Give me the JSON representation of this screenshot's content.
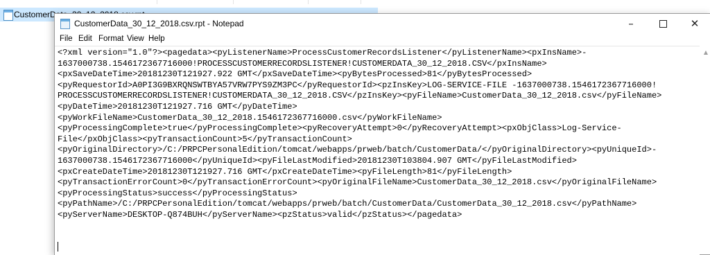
{
  "explorer": {
    "file_name": "CustomerData_30_12_2018.csv.rpt"
  },
  "window": {
    "title": "CustomerData_30_12_2018.csv.rpt - Notepad",
    "controls": {
      "minimize": "–",
      "close": "✕"
    }
  },
  "menu": [
    "File",
    "Edit",
    "Format",
    "View",
    "Help"
  ],
  "content_lines": [
    "<?xml version=\"1.0\"?><pagedata><pyListenerName>ProcessCustomerRecordsListener</pyListenerName><pxInsName>-",
    "1637000738.1546172367716000!PROCESSCUSTOMERRECORDSLISTENER!CUSTOMERDATA_30_12_2018.CSV</pxInsName>",
    "<pxSaveDateTime>20181230T121927.922 GMT</pxSaveDateTime><pyBytesProcessed>81</pyBytesProcessed>",
    "<pyRequestorId>A0PI3G9BXRQNSWTBYA57VRW7PYS9ZM3PC</pyRequestorId><pzInsKey>LOG-SERVICE-FILE -1637000738.1546172367716000!",
    "PROCESSCUSTOMERRECORDSLISTENER!CUSTOMERDATA_30_12_2018.CSV</pzInsKey><pyFileName>CustomerData_30_12_2018.csv</pyFileName>",
    "<pyDateTime>20181230T121927.716 GMT</pyDateTime>",
    "<pyWorkFileName>CustomerData_30_12_2018.1546172367716000.csv</pyWorkFileName>",
    "<pyProcessingComplete>true</pyProcessingComplete><pyRecoveryAttempt>0</pyRecoveryAttempt><pxObjClass>Log-Service-",
    "File</pxObjClass><pyTransactionCount>5</pyTransactionCount>",
    "<pyOriginalDirectory>/C:/PRPCPersonalEdition/tomcat/webapps/prweb/batch/CustomerData/</pyOriginalDirectory><pyUniqueId>-",
    "1637000738.1546172367716000</pyUniqueId><pyFileLastModified>20181230T103804.907 GMT</pyFileLastModified>",
    "<pxCreateDateTime>20181230T121927.716 GMT</pxCreateDateTime><pyFileLength>81</pyFileLength>",
    "<pyTransactionErrorCount>0</pyTransactionErrorCount><pyOriginalFileName>CustomerData_30_12_2018.csv</pyOriginalFileName>",
    "<pyProcessingStatus>success</pyProcessingStatus>",
    "<pyPathName>/C:/PRPCPersonalEdition/tomcat/webapps/prweb/batch/CustomerData/CustomerData_30_12_2018.csv</pyPathName>",
    "<pyServerName>DESKTOP-Q874BUH</pyServerName><pzStatus>valid</pzStatus></pagedata>"
  ]
}
